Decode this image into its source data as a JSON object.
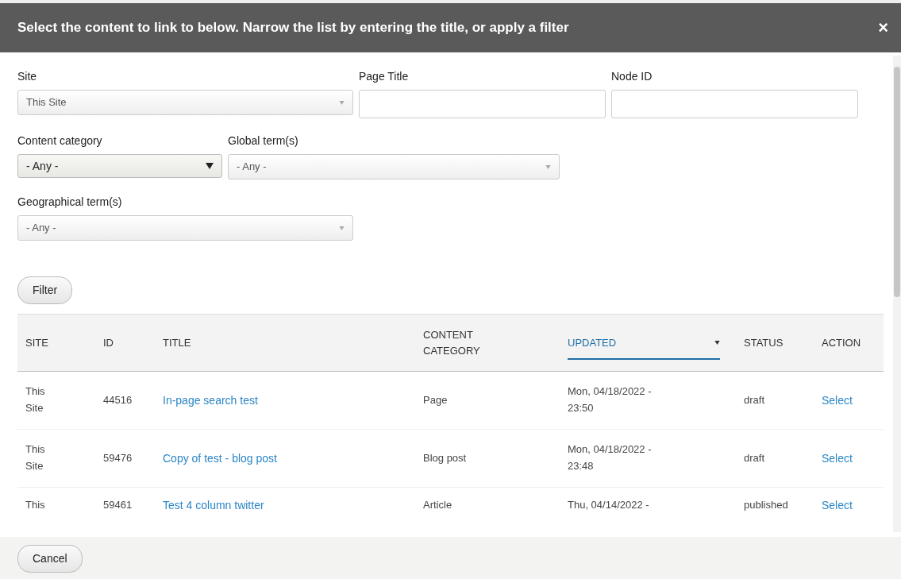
{
  "dialog": {
    "title": "Select the content to link to below. Narrow the list by entering the title, or apply a filter",
    "close": "×"
  },
  "filters": [
    {
      "label": "Site",
      "kind": "combobox",
      "value": "This Site"
    },
    {
      "label": "Page Title",
      "kind": "text"
    },
    {
      "label": "Node ID",
      "kind": "text"
    },
    {
      "label": "Content category",
      "kind": "dropdown",
      "value": "- Any -"
    },
    {
      "label": "Global term(s)",
      "kind": "combobox",
      "value": "- Any -"
    },
    {
      "label": "Geographical term(s)",
      "kind": "combobox",
      "value": "- Any -"
    }
  ],
  "filter_button": "Filter",
  "table": {
    "columns": [
      {
        "label": "SITE",
        "sorted": false
      },
      {
        "label": "ID",
        "sorted": false
      },
      {
        "label": "TITLE",
        "sorted": false
      },
      {
        "label": "CONTENT CATEGORY",
        "sorted": false
      },
      {
        "label": "UPDATED",
        "sorted": true
      },
      {
        "label": "STATUS",
        "sorted": false
      },
      {
        "label": "ACTION",
        "sorted": false
      }
    ],
    "rows": [
      {
        "site": "This Site",
        "id": "44516",
        "title": "In-page search test",
        "category": "Page",
        "updated": "Mon, 04/18/2022 - 23:50",
        "status": "draft",
        "action": "Select"
      },
      {
        "site": "This Site",
        "id": "59476",
        "title": "Copy of test - blog post",
        "category": "Blog post",
        "updated": "Mon, 04/18/2022 - 23:48",
        "status": "draft",
        "action": "Select"
      },
      {
        "site": "This",
        "id": "59461",
        "title": "Test 4 column twitter",
        "category": "Article",
        "updated": "Thu, 04/14/2022 -",
        "status": "published",
        "action": "Select"
      }
    ]
  },
  "cancel_button": "Cancel"
}
